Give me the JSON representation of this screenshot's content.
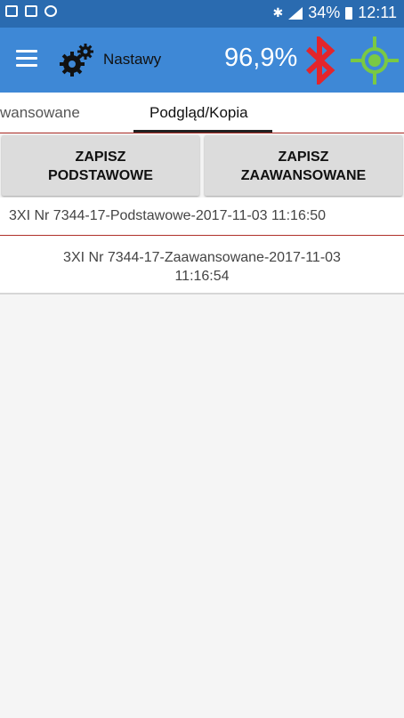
{
  "status_bar": {
    "battery": "34%",
    "time": "12:11"
  },
  "app_bar": {
    "title": "Nastawy",
    "percent": "96,9%",
    "colors": {
      "background": "#3e88d6",
      "bluetooth": "#e3252b",
      "gps": "#7ac943"
    }
  },
  "tabs": {
    "advanced": "wansowane",
    "preview": "Podgląd/Kopia"
  },
  "buttons": {
    "save_basic_line1": "ZAPISZ",
    "save_basic_line2": "PODSTAWOWE",
    "save_advanced_line1": "ZAPISZ",
    "save_advanced_line2": "ZAAWANSOWANE"
  },
  "files": [
    {
      "name": "3XI Nr 7344-17-Podstawowe-2017-11-03 11:16:50"
    },
    {
      "name": "3XI Nr 7344-17-Zaawansowane-2017-11-03 11:16:54"
    }
  ]
}
